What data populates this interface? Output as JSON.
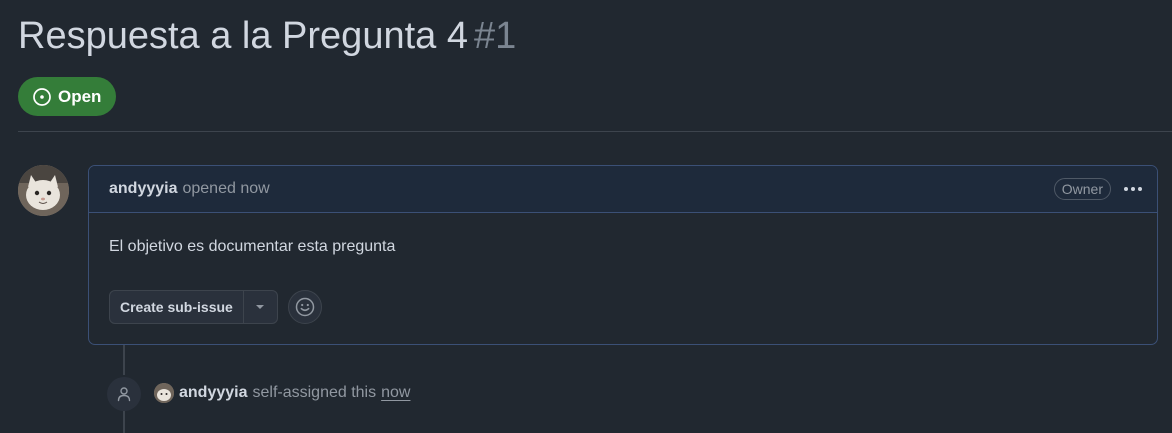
{
  "issue": {
    "title": "Respuesta a la Pregunta 4",
    "number": "#1",
    "state": "Open",
    "state_color": "#347d39"
  },
  "comment": {
    "author": "andyyyia",
    "meta": "opened now",
    "role_badge": "Owner",
    "body": "El objetivo es documentar esta pregunta",
    "border_color": "#3b5076",
    "header_bg": "#1e2a3b"
  },
  "actions": {
    "create_sub_issue": "Create sub-issue"
  },
  "timeline": {
    "events": [
      {
        "icon": "person-icon",
        "author": "andyyyia",
        "action": "self-assigned this",
        "time": "now"
      }
    ]
  },
  "theme": {
    "background": "#212830",
    "text": "#d1d7e0",
    "muted": "#9198a1"
  }
}
